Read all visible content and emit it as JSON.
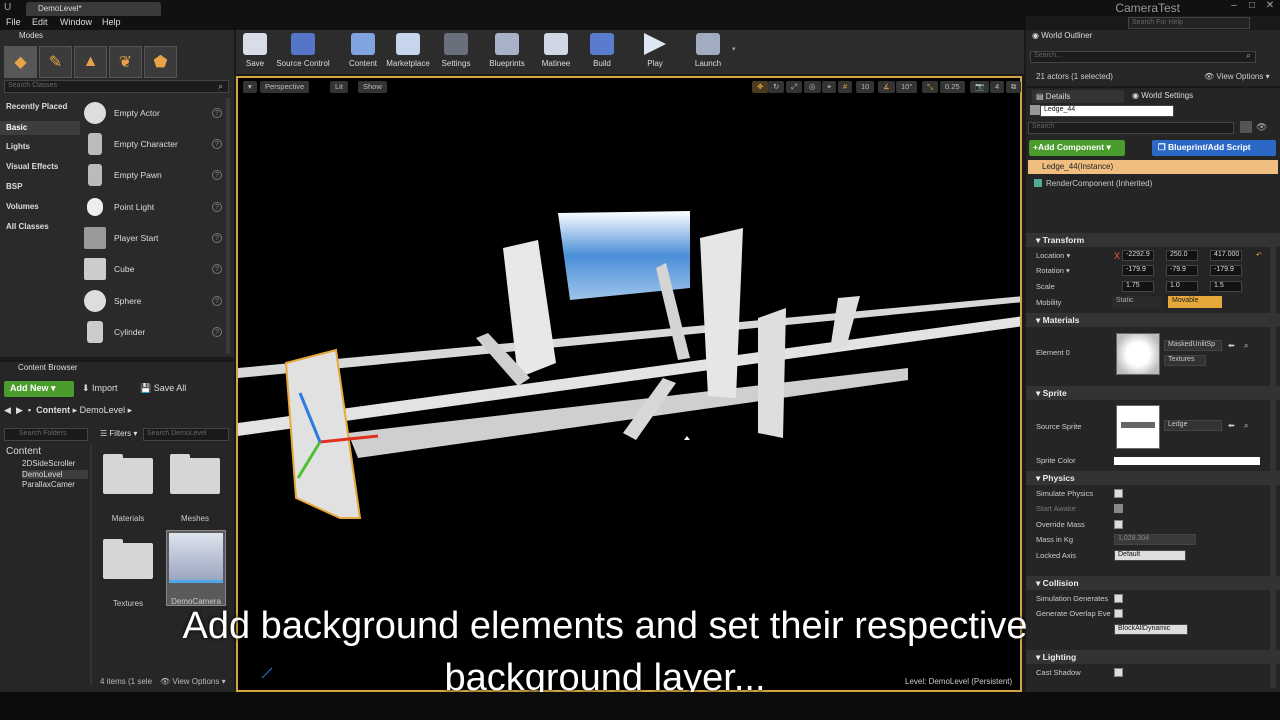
{
  "window": {
    "tab_title": "DemoLevel*",
    "project_name": "CameraTest",
    "search_help_placeholder": "Search For Help"
  },
  "menu": [
    "File",
    "Edit",
    "Window",
    "Help"
  ],
  "modes": {
    "tab": "Modes",
    "search_placeholder": "Search Classes",
    "categories": [
      "Recently Placed",
      "Basic",
      "Lights",
      "Visual Effects",
      "BSP",
      "Volumes",
      "All Classes"
    ],
    "items": [
      "Empty Actor",
      "Empty Character",
      "Empty Pawn",
      "Point Light",
      "Player Start",
      "Cube",
      "Sphere",
      "Cylinder"
    ]
  },
  "content_browser": {
    "tab": "Content Browser",
    "add_new": "Add New",
    "import": "Import",
    "save_all": "Save All",
    "path": [
      "Content",
      "DemoLevel"
    ],
    "folder_search": "Search Folders",
    "filters": "Filters",
    "asset_search": "Search DemoLevel",
    "tree": [
      "Content",
      "2DSideScroller",
      "DemoLevel",
      "ParallaxCamer"
    ],
    "assets": [
      "Materials",
      "Meshes",
      "Textures",
      "DemoCamera"
    ],
    "items_count": "4 items (1 sele",
    "view_options": "View Options"
  },
  "toolbar": [
    "Save",
    "Source Control",
    "Content",
    "Marketplace",
    "Settings",
    "Blueprints",
    "Matinee",
    "Build",
    "Play",
    "Launch"
  ],
  "viewport": {
    "perspective": "Perspective",
    "lit": "Lit",
    "show": "Show",
    "grid_snap": "10",
    "rot_snap": "10°",
    "scale_snap": "0.25",
    "speed": "4",
    "level_label": "Level:  DemoLevel (Persistent)"
  },
  "subtitle": {
    "line1": "Add background elements and set their respective",
    "line2": "background layer..."
  },
  "outliner": {
    "tab": "World Outliner",
    "search_placeholder": "Search...",
    "actor_count": "21 actors (1 selected)",
    "view_options": "View Options"
  },
  "details": {
    "tab": "Details",
    "world_settings_tab": "World Settings",
    "actor_name": "Ledge_44",
    "search_placeholder": "Search",
    "add_component": "+Add Component",
    "blueprint_script": "Blueprint/Add Script",
    "components": [
      "Ledge_44(Instance)",
      "RenderComponent (Inherited)"
    ],
    "transform": {
      "title": "Transform",
      "location_label": "Location",
      "rotation_label": "Rotation",
      "scale_label": "Scale",
      "mobility_label": "Mobility",
      "location": [
        "-2292.9",
        "250.0",
        "417.000"
      ],
      "rotation": [
        "-179.9",
        "-79.9",
        "-179.9"
      ],
      "scale": [
        "1.75",
        "1.0",
        "1.5"
      ],
      "static": "Static",
      "movable": "Movable"
    },
    "materials": {
      "title": "Materials",
      "element0": "Element 0",
      "material": "MaskedUnlitSp",
      "textures": "Textures"
    },
    "sprite": {
      "title": "Sprite",
      "source_sprite_label": "Source Sprite",
      "source_sprite": "Ledge",
      "sprite_color": "Sprite Color"
    },
    "physics": {
      "title": "Physics",
      "simulate": "Simulate Physics",
      "start_awake": "Start Awake",
      "override_mass": "Override Mass",
      "mass_kg": "Mass in Kg",
      "mass_value": "1,028.304",
      "locked_axis": "Locked Axis",
      "locked_value": "Default"
    },
    "collision": {
      "title": "Collision",
      "sim_generates": "Simulation Generates",
      "gen_overlap": "Generate Overlap Eve",
      "preset_value": "BlockAllDynamic"
    },
    "lighting": {
      "title": "Lighting",
      "cast_shadow": "Cast Shadow"
    }
  }
}
